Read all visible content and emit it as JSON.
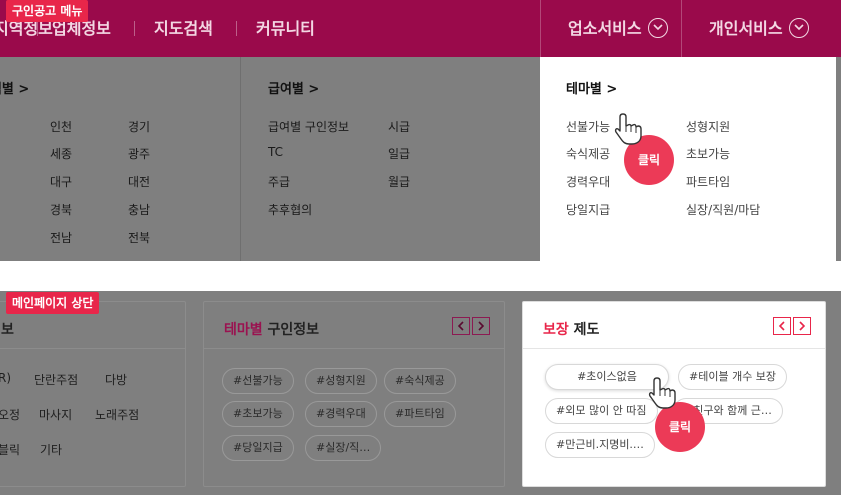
{
  "top_label": "구인공고 메뉴",
  "bottom_label": "메인페이지 상단",
  "click_label": "클릭",
  "navbar": {
    "items": [
      "지역정보",
      "업체정보",
      "지도검색",
      "커뮤니티"
    ],
    "biz_service": "업소서비스",
    "personal_service": "개인서비스"
  },
  "region": {
    "heading": "지역별 >",
    "col1": [
      "인천",
      "세종",
      "대구",
      "경북",
      "전남"
    ],
    "col2": [
      "경기",
      "광주",
      "대전",
      "충남",
      "전북"
    ]
  },
  "pay": {
    "heading": "급여별 >",
    "col1": [
      "급여별 구인정보",
      "TC",
      "주급",
      "추후협의"
    ],
    "col2": [
      "시급",
      "일급",
      "월급"
    ]
  },
  "theme": {
    "heading": "테마별 >",
    "col1": [
      "선불가능",
      "숙식제공",
      "경력우대",
      "당일지급"
    ],
    "col2": [
      "성형지원",
      "초보가능",
      "파트타임",
      "실장/직원/마담"
    ]
  },
  "card1": {
    "title_suffix": "보",
    "words": [
      "R)",
      "단란주점",
      "다방",
      "오정",
      "마사지",
      "노래주점",
      "블릭",
      "기타"
    ]
  },
  "card2": {
    "title_accent": "테마별",
    "title_rest": " 구인정보",
    "pills": [
      "#선불가능",
      "#성형지원",
      "#숙식제공",
      "#초보가능",
      "#경력우대",
      "#파트타임",
      "#당일지급",
      "#실장/직…"
    ]
  },
  "card3": {
    "title_accent": "보장",
    "title_rest": " 제도",
    "pills": [
      "#초이스없음",
      "#테이블 개수 보장",
      "#외모 많이 안 따짐",
      "#친구와 함께 근…",
      "#만근비.지명비.…"
    ]
  },
  "colors": {
    "navbar": "#9a0a4b",
    "accent_red": "#e8264a",
    "overlay_gray": "#7f7f7f"
  }
}
